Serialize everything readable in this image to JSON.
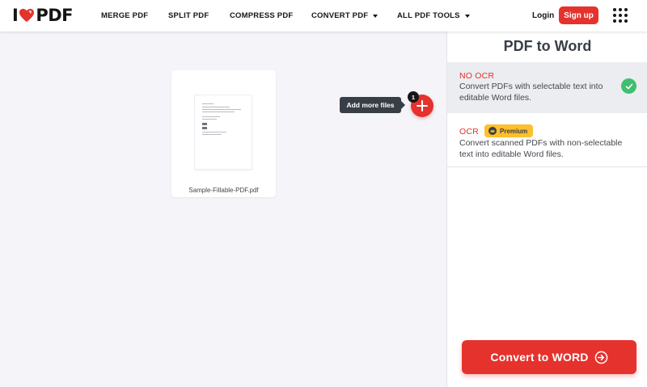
{
  "header": {
    "logo_left": "I",
    "logo_right": "PDF",
    "nav": [
      {
        "label": "MERGE PDF",
        "has_menu": false
      },
      {
        "label": "SPLIT PDF",
        "has_menu": false
      },
      {
        "label": "COMPRESS PDF",
        "has_menu": false
      },
      {
        "label": "CONVERT PDF",
        "has_menu": true
      },
      {
        "label": "ALL PDF TOOLS",
        "has_menu": true
      }
    ],
    "login_label": "Login",
    "signup_label": "Sign up",
    "apps_icon": "grid-menu-icon"
  },
  "workspace": {
    "file": {
      "name": "Sample-Fillable-PDF.pdf"
    },
    "add_more_tooltip": "Add more files",
    "file_count": "1"
  },
  "sidebar": {
    "title": "PDF to Word",
    "options": [
      {
        "title": "NO OCR",
        "description": "Convert PDFs with selectable text into editable Word files.",
        "selected": true
      },
      {
        "title": "OCR",
        "badge": "Premium",
        "description": "Convert scanned PDFs with non-selectable text into editable Word files.",
        "selected": false
      }
    ],
    "convert_label": "Convert to WORD"
  },
  "colors": {
    "brand_red": "#e5322d",
    "dark_text": "#383e45",
    "premium_yellow": "#fdbf2d",
    "check_green": "#3fbf6f",
    "workspace_bg": "#f4f4f9"
  }
}
